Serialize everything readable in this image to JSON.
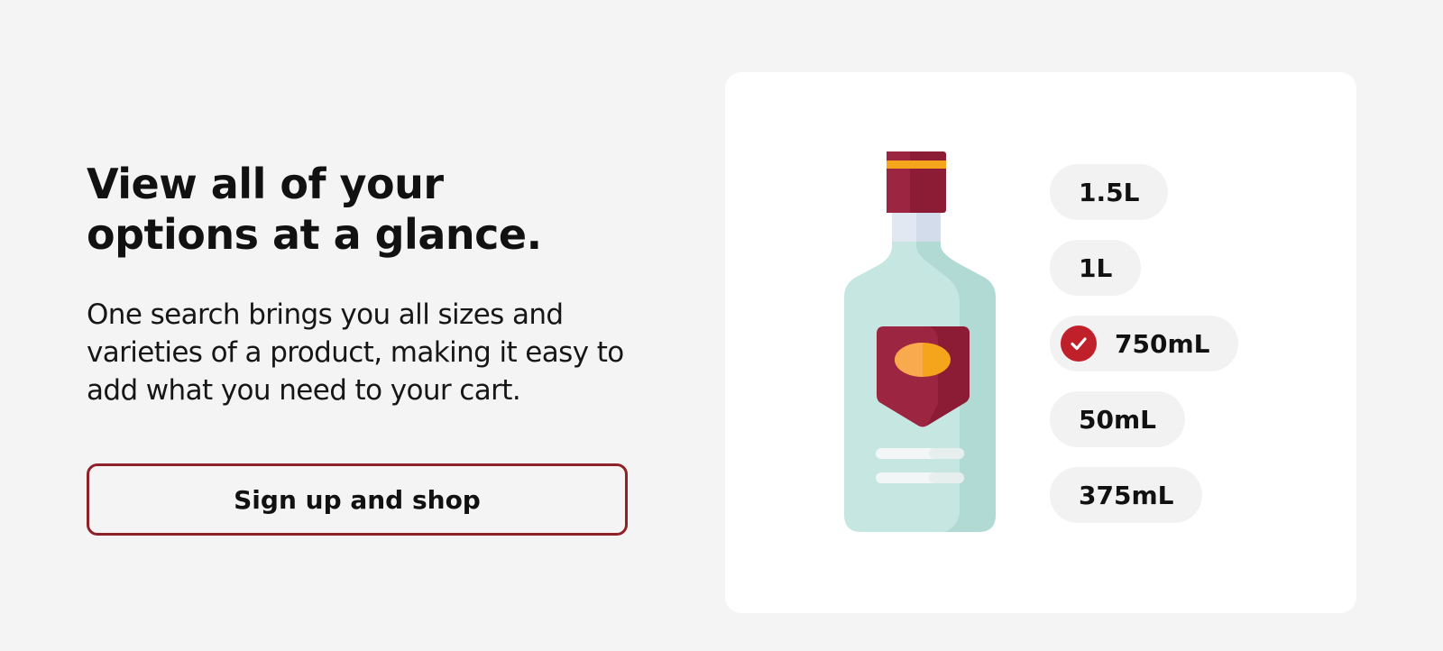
{
  "hero": {
    "headline": "View all of your options at a glance.",
    "body": "One search brings you all sizes and varieties of a product, making it easy to add what you need to your cart.",
    "cta_label": "Sign up and shop"
  },
  "product_card": {
    "bottle_icon": "liquor-bottle-icon",
    "sizes": [
      {
        "label": "1.5L",
        "selected": false
      },
      {
        "label": "1L",
        "selected": false
      },
      {
        "label": "750mL",
        "selected": true
      },
      {
        "label": "50mL",
        "selected": false
      },
      {
        "label": "375mL",
        "selected": false
      }
    ],
    "selected_icon": "check-circle-icon"
  },
  "colors": {
    "background": "#f4f4f4",
    "card": "#ffffff",
    "accent": "#8e2228",
    "check": "#c0202a",
    "pill": "#f2f2f2"
  }
}
